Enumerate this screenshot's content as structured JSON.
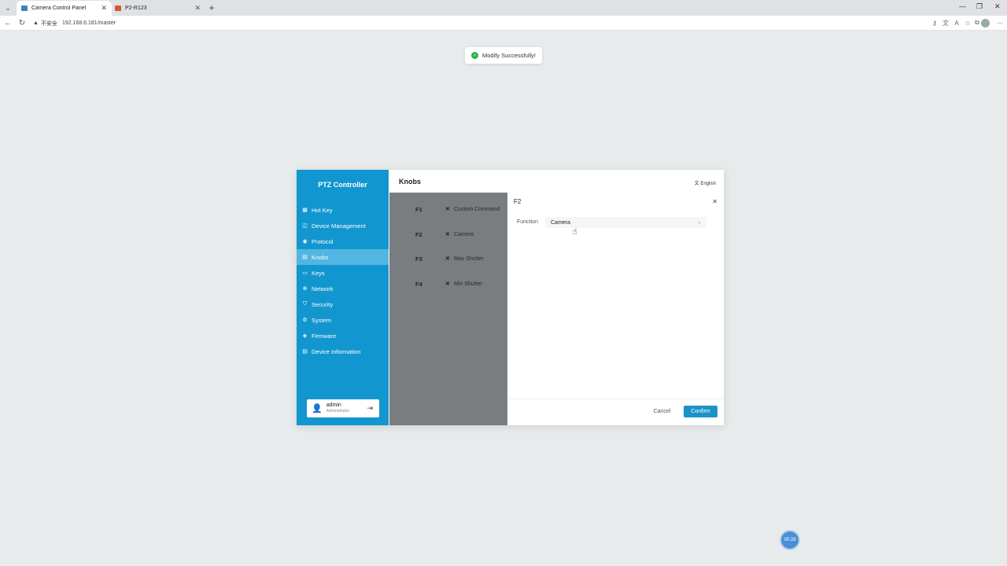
{
  "browser": {
    "tabs": [
      {
        "title": "Camera Control Panel",
        "favicon_color": "#3b82c4"
      },
      {
        "title": "P2-R123",
        "favicon_color": "#d9582b"
      }
    ],
    "address": {
      "insecure_label": "不安全",
      "url": "192.168.6.181/master"
    }
  },
  "toast": {
    "message": "Modify Successfully!"
  },
  "sidebar": {
    "brand": "PTZ Controller",
    "items": [
      {
        "label": "Hot Key",
        "icon": "hotkey-icon"
      },
      {
        "label": "Device Management",
        "icon": "camera-icon"
      },
      {
        "label": "Protocol",
        "icon": "protocol-icon"
      },
      {
        "label": "Knobs",
        "icon": "knob-icon"
      },
      {
        "label": "Keys",
        "icon": "keyboard-icon"
      },
      {
        "label": "Network",
        "icon": "globe-icon"
      },
      {
        "label": "Security",
        "icon": "shield-icon"
      },
      {
        "label": "System",
        "icon": "gear-icon"
      },
      {
        "label": "Firmware",
        "icon": "layers-icon"
      },
      {
        "label": "Device Information",
        "icon": "info-card-icon"
      }
    ],
    "active": "Knobs",
    "user": {
      "name": "admin",
      "role": "Administrator"
    }
  },
  "main": {
    "title": "Knobs",
    "language": "English",
    "knobs": [
      {
        "key": "F1",
        "value": "Custom Command"
      },
      {
        "key": "F2",
        "value": "Camera"
      },
      {
        "key": "F3",
        "value": "Max Shutter"
      },
      {
        "key": "F4",
        "value": "Min Shutter"
      }
    ]
  },
  "drawer": {
    "title": "F2",
    "function_label": "Function",
    "function_value": "Camera",
    "cancel_label": "Cancel",
    "confirm_label": "Confirm"
  },
  "timer": {
    "value": "00:28"
  },
  "colors": {
    "sidebar": "#1296cf",
    "sidebar_active": "#52b6e2",
    "confirm": "#1a94c8",
    "success": "#2fb24c"
  }
}
